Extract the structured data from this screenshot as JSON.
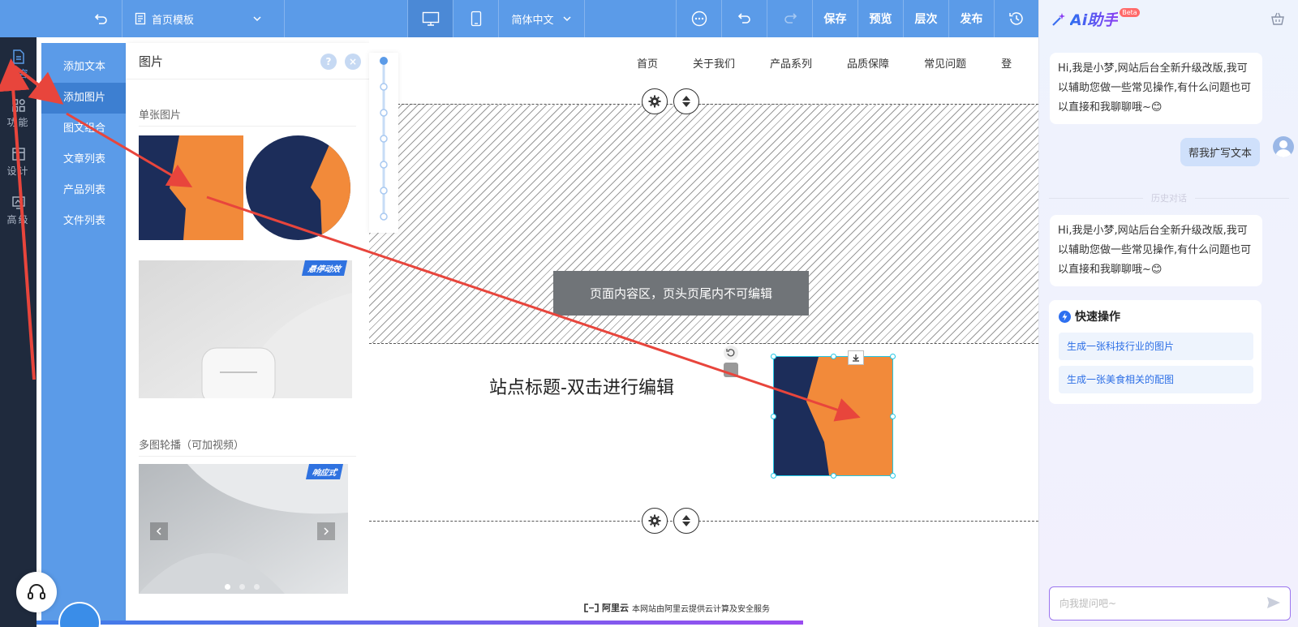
{
  "toolbar": {
    "template_label": "首页模板",
    "language_label": "简体中文",
    "save_label": "保存",
    "preview_label": "预览",
    "layers_label": "层次",
    "publish_label": "发布"
  },
  "rail": {
    "items": [
      {
        "label": "内容",
        "icon": "document-icon"
      },
      {
        "label": "功能",
        "icon": "apps-icon"
      },
      {
        "label": "设计",
        "icon": "design-icon"
      },
      {
        "label": "高级",
        "icon": "advanced-icon"
      }
    ]
  },
  "submenu": {
    "items": [
      "添加文本",
      "添加图片",
      "图文组合",
      "文章列表",
      "产品列表",
      "文件列表"
    ],
    "active": 1
  },
  "panel": {
    "title": "图片",
    "help_glyph": "?",
    "close_glyph": "×",
    "single_label": "单张图片",
    "hover_badge": "悬停动效",
    "carousel_label": "多图轮播（可加视频）",
    "responsive_badge": "响应式"
  },
  "canvas": {
    "nav": [
      "首页",
      "关于我们",
      "产品系列",
      "品质保障",
      "常见问题",
      "登"
    ],
    "notice": "页面内容区，页头页尾内不可编辑",
    "site_title": "站点标题-双击进行编辑",
    "footer_brand": "阿里云",
    "footer_text": "本网站由阿里云提供云计算及安全服务"
  },
  "ai": {
    "title": "Ai助手",
    "beta": "Beta",
    "greeting": "Hi,我是小梦,网站后台全新升级改版,我可以辅助您做一些常见操作,有什么问题也可以直接和我聊聊哦~😊",
    "user_message": "帮我扩写文本",
    "history_label": "历史对话",
    "greeting_2": "Hi,我是小梦,网站后台全新升级改版,我可以辅助您做一些常见操作,有什么问题也可以直接和我聊聊哦~😊",
    "quick_title": "快速操作",
    "quick_items": [
      "生成一张科技行业的图片",
      "生成一张美食相关的配图"
    ],
    "input_placeholder": "向我提问吧~"
  },
  "colors": {
    "toolbar": "#5b9be8",
    "rail": "#1f2a3d",
    "accent_orange": "#f28a3a",
    "navy": "#1c2d5a",
    "arrow_red": "#e8453c"
  }
}
